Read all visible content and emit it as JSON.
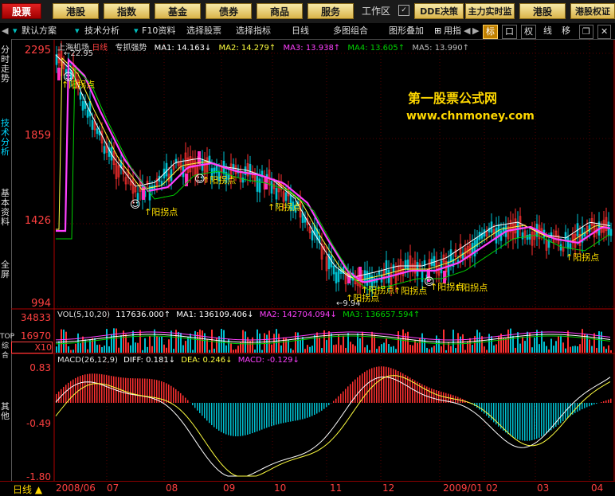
{
  "topbar": {
    "left_buttons": [
      "股票",
      "港股",
      "指数",
      "基金",
      "债券",
      "商品",
      "服务"
    ],
    "workspace": "工作区",
    "right_buttons": [
      "DDE决策",
      "主力实时监",
      "港股",
      "港股权证"
    ]
  },
  "menubar": {
    "items": [
      "默认方案",
      "技术分析",
      "F10资料",
      "选择股票",
      "选择指标",
      "日线",
      "多图组合",
      "图形叠加",
      "用指"
    ],
    "icons": [
      "标",
      "口",
      "权",
      "线",
      "移"
    ]
  },
  "sidebar": {
    "tabs": [
      "分时走势",
      "技术分析",
      "基本资料",
      "全屏",
      "TOP综合",
      "其他"
    ]
  },
  "stock": {
    "name": "上海机场",
    "period": "日线",
    "indicator": "专抓强势"
  },
  "main_axis": {
    "labels": [
      "2295",
      "1859",
      "1426",
      "994"
    ],
    "high_note": "22.95",
    "low_note": "9.94"
  },
  "ma_legend": [
    "MA1: 14.163↓",
    "MA2: 14.279↑",
    "MA3: 13.938↑",
    "MA4: 13.605↑",
    "MA5: 13.990↑"
  ],
  "vol": {
    "title": "VOL(5,10,20)",
    "value": "117636.000↑",
    "ma1": "MA1: 136109.406↓",
    "ma2": "MA2: 142704.094↓",
    "ma3": "MA3: 136657.594↑",
    "axis": [
      "34833",
      "16970"
    ],
    "unit": "X10"
  },
  "macd": {
    "title": "MACD(26,12,9)",
    "diff": "DIFF: 0.181↓",
    "dea": "DEA: 0.246↓",
    "macd": "MACD: -0.129↓",
    "axis": [
      "0.83",
      "-0.49",
      "-1.80"
    ]
  },
  "signal_label": "阳拐点",
  "watermark": {
    "line1": "第一股票公式网",
    "line2": "www.chnmoney.com"
  },
  "bottom": {
    "period": "日线",
    "dates": [
      "2008/06",
      "07",
      "08",
      "09",
      "10",
      "11",
      "12",
      "2009/01",
      "02",
      "03",
      "04"
    ]
  },
  "colors": {
    "up": "#ff3030",
    "down": "#00c0d0",
    "ma1": "#ffffff",
    "ma2": "#ffff40",
    "ma3": "#ff40ff",
    "ma4": "#00d000",
    "pink": "#ff30c0"
  }
}
